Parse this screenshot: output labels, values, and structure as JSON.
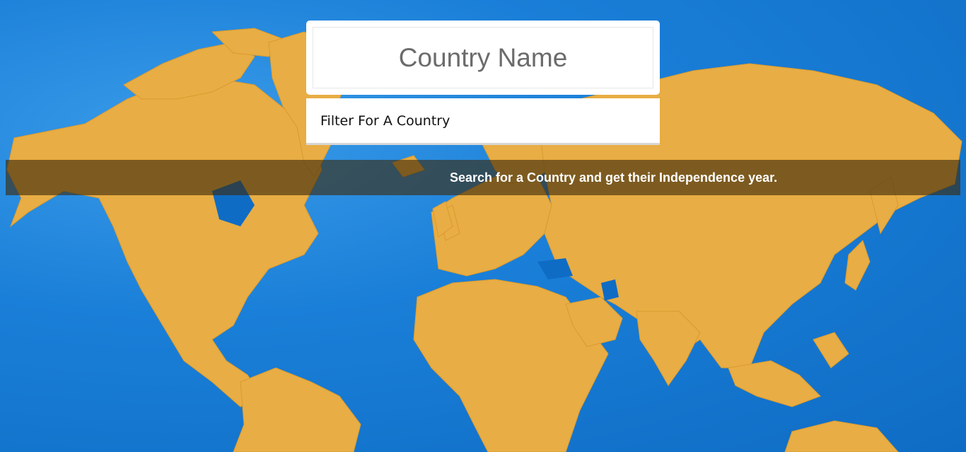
{
  "header": {
    "title": "Country Name"
  },
  "search": {
    "placeholder": "Filter For A Country",
    "value": ""
  },
  "banner": {
    "text": "Search for a Country and get their Independence year."
  },
  "colors": {
    "ocean": "#1a7fd8",
    "land": "#e8ad44",
    "banner_bg": "rgba(60,40,10,0.62)"
  }
}
